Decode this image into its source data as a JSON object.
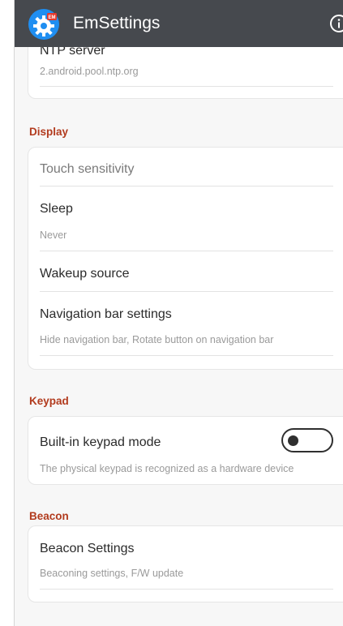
{
  "app": {
    "title": "EmSettings",
    "logo_icon": "gear-icon",
    "logo_badge_text": "EM",
    "info_icon": "info-icon"
  },
  "top_card": {
    "partial_title": "NTP server",
    "value": "2.android.pool.ntp.org"
  },
  "sections": {
    "display": {
      "header": "Display",
      "items": [
        {
          "title": "Touch sensitivity"
        },
        {
          "title": "Sleep",
          "subtitle": "Never"
        },
        {
          "title": "Wakeup source"
        },
        {
          "title": "Navigation bar settings",
          "subtitle": "Hide navigation bar, Rotate button on navigation bar"
        }
      ]
    },
    "keypad": {
      "header": "Keypad",
      "items": [
        {
          "title": "Built-in keypad mode",
          "subtitle": "The physical keypad is recognized as a hardware device",
          "toggle_on": false
        }
      ]
    },
    "beacon": {
      "header": "Beacon",
      "items": [
        {
          "title": "Beacon Settings",
          "subtitle": "Beaconing settings, F/W update"
        }
      ]
    }
  },
  "colors": {
    "appbar": "#46494e",
    "section_header": "#b23b1e",
    "logo_blue": "#1f8ef1",
    "logo_badge": "#e5392d"
  }
}
